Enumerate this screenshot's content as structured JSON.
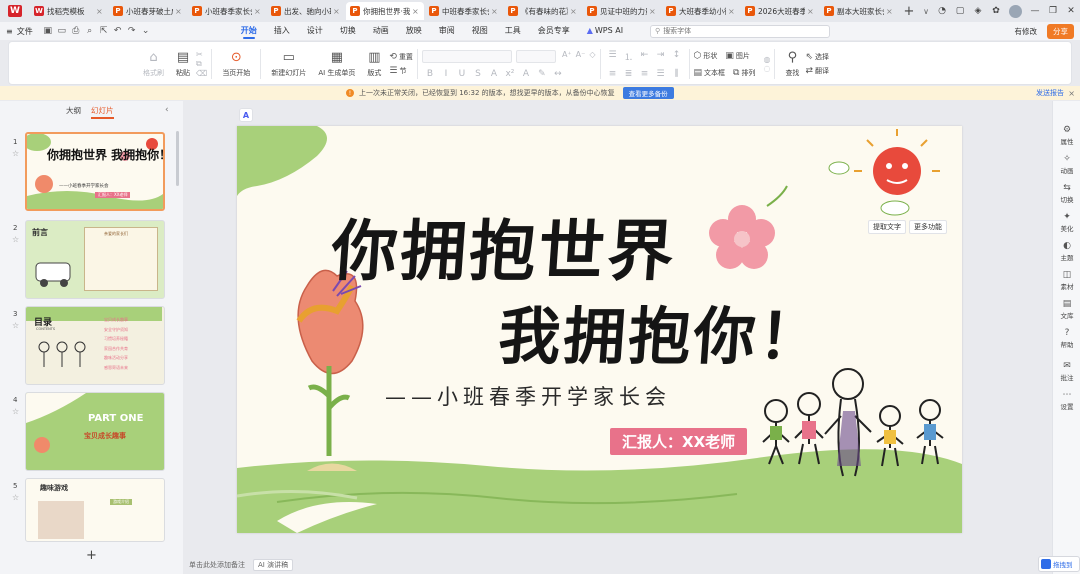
{
  "tabs": {
    "home_icon": "W",
    "items": [
      {
        "icon": "wps",
        "title": "找稻壳模板"
      },
      {
        "icon": "ppt",
        "title": "小班春芽破土成长"
      },
      {
        "icon": "ppt",
        "title": "小班春季家长会"
      },
      {
        "icon": "ppt",
        "title": "出发、驰向小班"
      },
      {
        "icon": "ppt",
        "title": "你拥抱世界·我"
      },
      {
        "icon": "ppt",
        "title": "中班春季家长会"
      },
      {
        "icon": "ppt",
        "title": "《有春味的花》"
      },
      {
        "icon": "ppt",
        "title": "见证中班的力量"
      },
      {
        "icon": "ppt",
        "title": "大班春季幼小衔接"
      },
      {
        "icon": "ppt",
        "title": "2026大班春季"
      },
      {
        "icon": "ppt",
        "title": "副本大班家长会"
      }
    ],
    "new_tab": "+",
    "dropdown": "∨"
  },
  "menubar": {
    "file": "文件",
    "tabs": [
      "开始",
      "插入",
      "设计",
      "切换",
      "动画",
      "放映",
      "审阅",
      "视图",
      "工具",
      "会员专享"
    ],
    "active_tab": "开始",
    "wps_ai": "WPS AI",
    "search_placeholder": "搜索字体",
    "edit_label": "有修改",
    "share_label": "分享"
  },
  "ribbon": {
    "format_painter": "格式刷",
    "paste": "粘贴",
    "start_current": "当页开始",
    "new_slide": "新建幻灯片",
    "ai_generate": "AI 生成单页",
    "layout": "版式",
    "section": "节",
    "reset": "重置",
    "shape": "形状",
    "picture": "图片",
    "textbox": "文本框",
    "arrange": "排列",
    "find": "查找",
    "select": "选择",
    "translate": "翻译"
  },
  "notice": {
    "text": "上一次未正常关闭，已经恢复到 16:32 的版本，想找更早的版本，从备份中心恢复",
    "button": "查看更多备份",
    "link": "发送报告",
    "close": "×"
  },
  "left_panel": {
    "tab_outline": "大纲",
    "tab_slides": "幻灯片",
    "slides": [
      {
        "num": "1",
        "title": "你拥抱世界 我拥抱你！",
        "sub": "——小班春季开学家长会",
        "badge": "汇报人：XX老师"
      },
      {
        "num": "2",
        "title": "前言",
        "sub": "亲爱的家长们"
      },
      {
        "num": "3",
        "title": "目录",
        "sub": "CONTENTS",
        "items": [
          "宝贝成长趣事",
          "安全守护须知",
          "习惯培养秘籍",
          "家园合作共育",
          "趣味活动分享",
          "感恩寄语未来"
        ]
      },
      {
        "num": "4",
        "title": "PART ONE",
        "sub": "宝贝成长趣事"
      },
      {
        "num": "5",
        "title": "趣味游戏",
        "sub": "游戏介绍"
      }
    ],
    "add": "+"
  },
  "slide": {
    "title_line1": "你拥抱世界",
    "title_line2": "我拥抱你！",
    "subtitle": "——小班春季开学家长会",
    "reporter": "汇报人：XX老师"
  },
  "float_toolbar": {
    "extract_text": "提取文字",
    "more": "更多功能"
  },
  "ai_badge": "A",
  "status": {
    "note_placeholder": "单击此处添加备注",
    "ai_speech": "AI 演讲稿"
  },
  "right_panel": {
    "items": [
      "属性",
      "动画",
      "切换",
      "美化",
      "主题",
      "素材",
      "文库",
      "帮助",
      "批注",
      "设置"
    ]
  },
  "bottom_ai": "拖拽到",
  "colors": {
    "accent": "#2e6ce8",
    "ppt_orange": "#e9570a",
    "share_orange": "#f07a25",
    "slide_pink": "#e8728a",
    "grass_green": "#a8d07a",
    "sun_red": "#e84a3c"
  }
}
